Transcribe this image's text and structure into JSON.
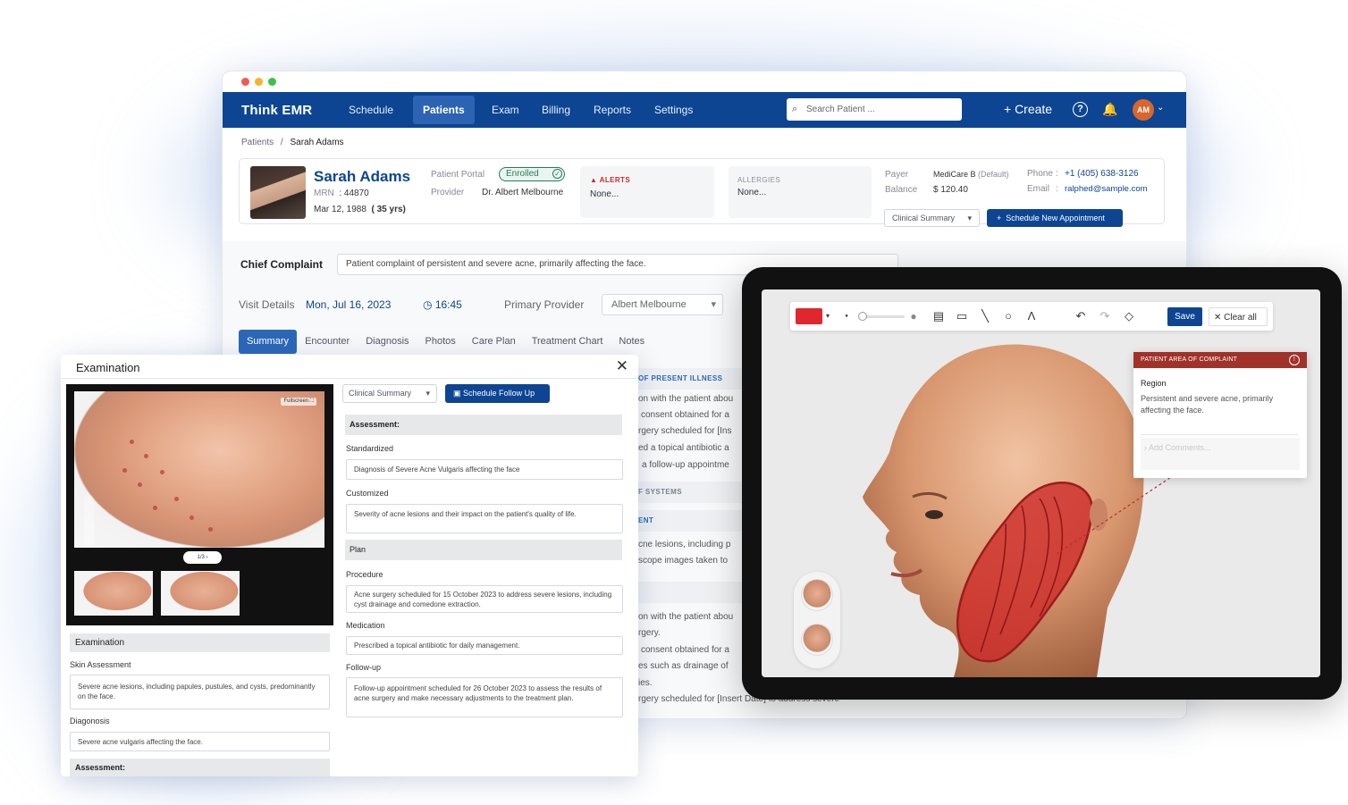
{
  "colors": {
    "brand": "#0d4593",
    "accent": "#2c68b8",
    "alert": "#c72a2a",
    "enrolled": "#2a7a5a",
    "annotation": "#a1322a"
  },
  "app": {
    "logo": "Think EMR",
    "nav": [
      "Schedule",
      "Patients",
      "Exam",
      "Billing",
      "Reports",
      "Settings"
    ],
    "active_nav": "Patients",
    "search_placeholder": "Search Patient ...",
    "create_label": "+ Create",
    "avatar": "AM"
  },
  "breadcrumb": {
    "parent": "Patients",
    "separator": "/",
    "current": "Sarah Adams"
  },
  "patient": {
    "name": "Sarah Adams",
    "mrn_label": "MRN",
    "mrn": "44870",
    "dob": "Mar 12, 1988",
    "age": "( 35 yrs)",
    "portal_label": "Patient Portal",
    "portal_status": "Enrolled",
    "provider_label": "Provider",
    "provider": "Dr. Albert Melbourne",
    "alerts_label": "ALERTS",
    "alerts_value": "None...",
    "allergies_label": "ALLERGIES",
    "allergies_value": "None...",
    "payer_label": "Payer",
    "payer": "MediCare B",
    "payer_note": "(Default)",
    "balance_label": "Balance",
    "balance": "$ 120.40",
    "phone_label": "Phone",
    "phone": "+1 (405) 638-3126",
    "email_label": "Email",
    "email": "ralphed@sample.com",
    "clinical_summary": "Clinical Summary",
    "schedule_new": "Schedule New Appointment"
  },
  "complaint": {
    "label": "Chief Complaint",
    "value": "Patient complaint of persistent and severe acne, primarily affecting the face."
  },
  "visit": {
    "label": "Visit Details",
    "date": "Mon, Jul 16, 2023",
    "time": "16:45",
    "provider_label": "Primary Provider",
    "provider": "Albert Melbourne"
  },
  "tabs": [
    "Summary",
    "Encounter",
    "Diagnosis",
    "Photos",
    "Care Plan",
    "Treatment Chart",
    "Notes"
  ],
  "background": {
    "heads": [
      "OF PRESENT ILLNESS",
      "F SYSTEMS",
      "ENT"
    ],
    "lines": [
      "on with the patient abou",
      "consent obtained for a",
      "rgery scheduled for [Ins",
      "ed a topical antibiotic a",
      "a follow-up appointme",
      "cne lesions, including p",
      "scope images taken to",
      "on with the patient abou",
      "rgery.",
      "consent obtained for a",
      "es such as drainage of",
      "ies.",
      "rgery scheduled for [Insert Date] to address severe"
    ]
  },
  "exam": {
    "title": "Examination",
    "fullscreen": "Fullscreen",
    "pager": "1/3",
    "examination_header": "Examination",
    "skin_label": "Skin Assessment",
    "skin_value": "Severe acne lesions, including papules, pustules, and cysts, predominantly on the face.",
    "diag_label": "Diagonosis",
    "diag_value": "Severe acne vulgaris affecting the face.",
    "assessment_footer": "Assessment:",
    "clinical_summary": "Clinical Summary",
    "schedule_followup": "Schedule Follow Up",
    "assessment_header": "Assessment:",
    "standardized_label": "Standardized",
    "standardized_value": "Diagnosis of Severe Acne Vulgaris affecting the face",
    "customized_label": "Customized",
    "customized_value": "Severity of acne lesions and their impact on the patient's quality of life.",
    "plan_header": "Plan",
    "procedure_label": "Procedure",
    "procedure_value": "Acne surgery scheduled for 15 October 2023 to address severe lesions, including cyst drainage and comedone extraction.",
    "medication_label": "Medication",
    "medication_value": "Prescribed a topical antibiotic for daily management.",
    "followup_label": "Follow-up",
    "followup_value": "Follow-up appointment scheduled for 26 October 2023 to assess the results of acne surgery and make necessary adjustments to the treatment plan."
  },
  "tablet": {
    "save": "Save",
    "clear": "Clear all",
    "panel_title": "PATIENT AREA OF COMPLAINT",
    "region_label": "Region",
    "region_value": "Persistent and severe acne, primarily affecting the face.",
    "comment_placeholder": "Add Comments..."
  }
}
